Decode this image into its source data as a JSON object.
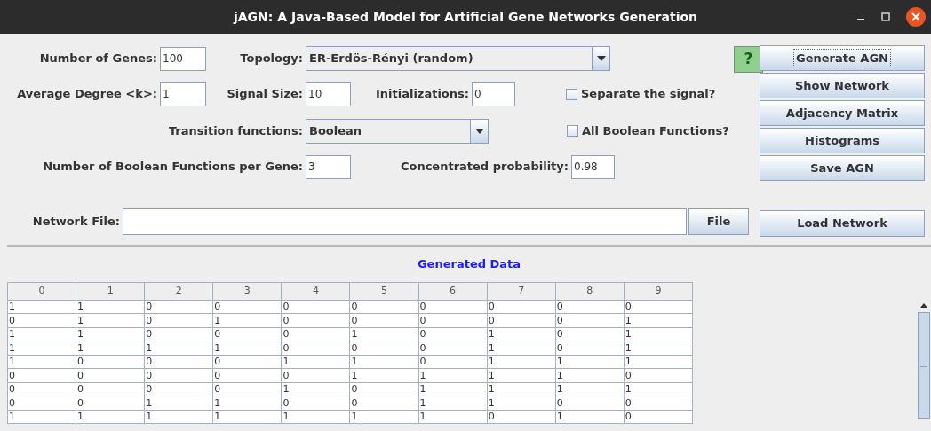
{
  "window": {
    "title": "jAGN: A Java-Based Model for Artificial Gene Networks Generation"
  },
  "form": {
    "genes": {
      "label": "Number of Genes:",
      "value": "100"
    },
    "topology": {
      "label": "Topology:",
      "value": "ER-Erdös-Rényi (random)"
    },
    "help_button": {
      "text": "?"
    },
    "average_degree": {
      "label": "Average Degree <k>:",
      "value": "1"
    },
    "signal_size": {
      "label": "Signal Size:",
      "value": "10"
    },
    "initializations": {
      "label": "Initializations:",
      "value": "0"
    },
    "separate_signal": {
      "label": "Separate the signal?",
      "checked": false
    },
    "transition_functions": {
      "label": "Transition functions:",
      "value": "Boolean"
    },
    "all_boolean_functions": {
      "label": "All Boolean Functions?",
      "checked": false
    },
    "functions_per_gene": {
      "label": "Number of Boolean Functions per Gene:",
      "value": "3"
    },
    "concentrated_probability": {
      "label": "Concentrated probability:",
      "value": "0.98"
    },
    "network_file": {
      "label": "Network File:"
    },
    "file_button": "File"
  },
  "buttons": [
    {
      "label": "Generate AGN",
      "focused": true
    },
    {
      "label": "Show Network",
      "focused": false
    },
    {
      "label": "Adjacency Matrix",
      "focused": false
    },
    {
      "label": "Histograms",
      "focused": false
    },
    {
      "label": "Save AGN",
      "focused": false
    }
  ],
  "load_button": "Load Network",
  "data": {
    "title": "Generated Data",
    "columns": [
      "0",
      "1",
      "2",
      "3",
      "4",
      "5",
      "6",
      "7",
      "8",
      "9"
    ],
    "rows": [
      [
        "1",
        "1",
        "0",
        "0",
        "0",
        "0",
        "0",
        "0",
        "0",
        "0"
      ],
      [
        "0",
        "1",
        "0",
        "1",
        "0",
        "0",
        "0",
        "0",
        "0",
        "1"
      ],
      [
        "1",
        "1",
        "0",
        "0",
        "0",
        "1",
        "0",
        "1",
        "0",
        "1"
      ],
      [
        "1",
        "1",
        "1",
        "1",
        "0",
        "0",
        "0",
        "1",
        "0",
        "1"
      ],
      [
        "1",
        "0",
        "0",
        "0",
        "1",
        "1",
        "0",
        "1",
        "1",
        "1"
      ],
      [
        "0",
        "0",
        "0",
        "0",
        "0",
        "1",
        "1",
        "1",
        "1",
        "0"
      ],
      [
        "0",
        "0",
        "0",
        "0",
        "1",
        "0",
        "1",
        "1",
        "1",
        "1"
      ],
      [
        "0",
        "0",
        "1",
        "1",
        "0",
        "0",
        "1",
        "1",
        "0",
        "0"
      ],
      [
        "1",
        "1",
        "1",
        "1",
        "1",
        "1",
        "1",
        "0",
        "1",
        "0"
      ]
    ]
  }
}
